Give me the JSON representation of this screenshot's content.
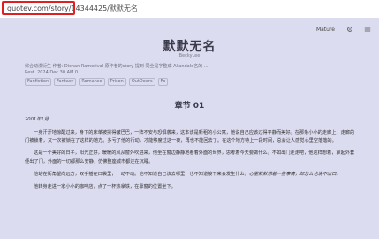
{
  "browser": {
    "url_host_path": "quotev.com/story/14344425/",
    "url_suffix": "默默无名"
  },
  "controls": {
    "mature_label": "Mature"
  },
  "story": {
    "title": "默默无名",
    "author": "BeckyLee",
    "meta_line_1": "综合动漫衍生  作者: Dichan Ramerival  原作者的story 提到  同全是字整成 Allandale名的 ...",
    "meta_line_2": "Rest. 2024 Dec 30 AM 0 ...",
    "tags": [
      "Fanfiction",
      "Fantasy",
      "Romance",
      "Prison",
      "OutDoors",
      "Fo"
    ]
  },
  "chapter": {
    "title": "章节 01",
    "date": "2001年1月",
    "paragraphs": [
      "一身汗汗地惊醒过来，身下的床单被揉得皱巴巴，一阵不安与恐惧袭来，这本该是新租的小公寓，他说自己应该过得平静而美好。在那条小小的走廊上，走廊的门被锁着，又一次被锁在了这样的地方。多亏了他的行动，才能够度过这一夜，再也不能回去了。在这个地方待上一段时间，总会让人感觉心里空落落的。",
      "这是一个美好的日子，阳光正好，暖暖的风从窗外吹进来，他坐在窗边静静地看着外面的世界，思考着今天要做什么。不如出门走走吧，他这样想着，拿起外套便出了门，外面的一切都那么安静，仿佛整座城市都还在沉睡。",
      "他站在街角望向远方，双手插在口袋里，一动不动。他不知道自己该去哪里，也不知道接下来会发生什么，",
      "他转身走进一家小小的咖啡店，点了一杯热拿铁，在靠窗的位置坐下。"
    ],
    "para3_italic": "心里默默想着一些事情，却怎么也说不出口。"
  }
}
